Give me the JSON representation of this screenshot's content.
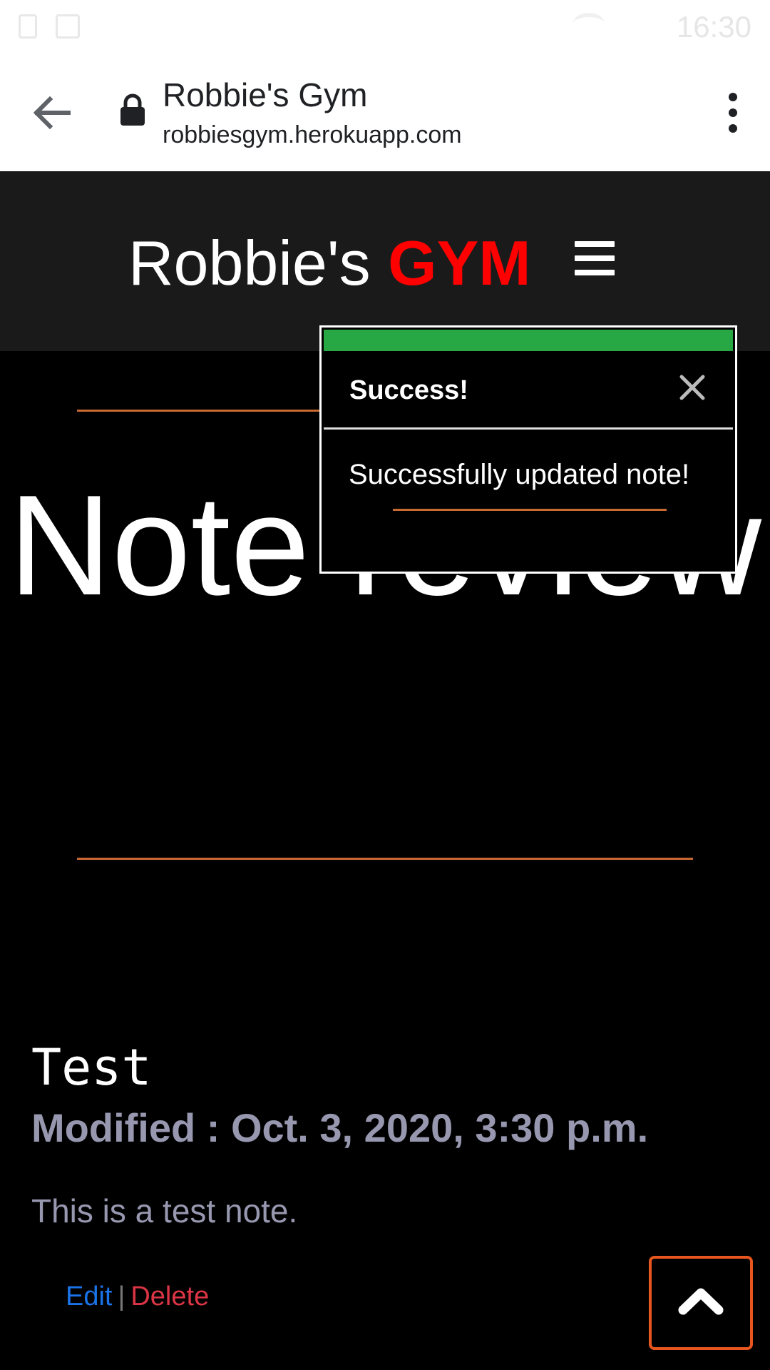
{
  "status_bar": {
    "time": "16:30",
    "icons": [
      "notification-icon",
      "image-icon",
      "wifi-icon"
    ]
  },
  "browser": {
    "title": "Robbie's Gym",
    "url": "robbiesgym.herokuapp.com",
    "icons": [
      "back-arrow-icon",
      "lock-icon",
      "more-vert-icon"
    ]
  },
  "header": {
    "brand_main": "Robbie's ",
    "brand_accent": "GYM",
    "menu_icon": "hamburger-icon",
    "brand_accent_color": "#ff0000"
  },
  "main": {
    "title": "Note review"
  },
  "note": {
    "title": "Test",
    "modified": "Modified : Oct. 3, 2020, 3:30 p.m.",
    "body": "This is a test note.",
    "edit_label": "Edit",
    "separator": "|",
    "delete_label": "Delete"
  },
  "toast": {
    "title": "Success!",
    "message": "Successfully updated note!",
    "close_icon": "close-icon",
    "accent_color": "#28a745"
  },
  "back_to_top": {
    "icon": "chevron-up-icon",
    "border_color": "#e8561f"
  }
}
